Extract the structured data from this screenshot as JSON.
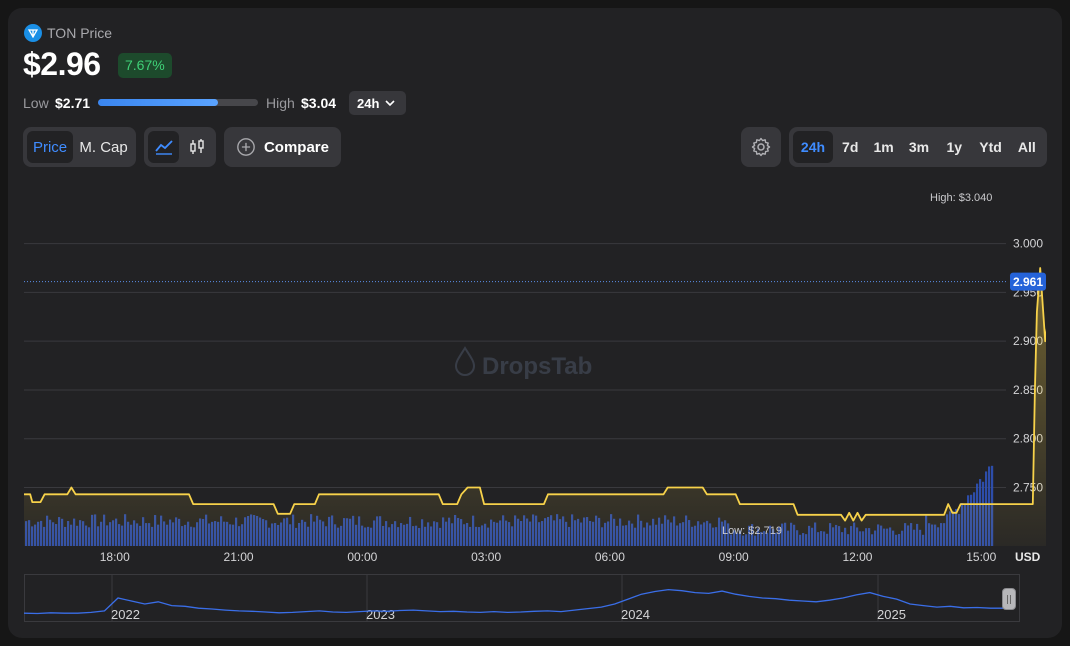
{
  "header": {
    "coin_name": "TON Price",
    "price": "$2.96",
    "change": "7.67%",
    "low_label": "Low",
    "low_value": "$2.71",
    "high_label": "High",
    "high_value": "$3.04",
    "period": "24h",
    "range_position": 0.75
  },
  "toolbar": {
    "price_tab": "Price",
    "mcap_tab": "M. Cap",
    "compare_label": "Compare",
    "ranges": [
      "24h",
      "7d",
      "1m",
      "3m",
      "1y",
      "Ytd",
      "All"
    ],
    "active_range": "24h"
  },
  "colors": {
    "line": "#f7d24a",
    "volume": "#2f52b8",
    "accent": "#3f8cff",
    "positive": "#3fd077",
    "navigator": "#3a6ee8"
  },
  "chart_data": [
    {
      "type": "line",
      "title": "",
      "xlabel": "",
      "ylabel": "USD",
      "x_ticks": [
        "18:00",
        "21:00",
        "00:00",
        "03:00",
        "06:00",
        "09:00",
        "12:00",
        "15:00"
      ],
      "x_range_hours": [
        -2.2,
        21.6
      ],
      "ylim": [
        2.69,
        3.055
      ],
      "y_ticks": [
        3.0,
        2.95,
        2.9,
        2.85,
        2.8,
        2.75
      ],
      "y_tick_labels": [
        "3.000",
        "2.950",
        "2.900",
        "2.850",
        "2.800",
        "2.750"
      ],
      "current_value": 2.961,
      "current_label": "2.961",
      "high_annotation": "High: $3.040",
      "low_annotation": "Low: $2.719",
      "watermark": "DropsTab",
      "series": [
        {
          "points": [
            [
              -2.2,
              2.743
            ],
            [
              -2.05,
              2.743
            ],
            [
              -2.0,
              2.735
            ],
            [
              -1.8,
              2.735
            ],
            [
              -1.7,
              2.743
            ],
            [
              -1.15,
              2.743
            ],
            [
              -1.05,
              2.75
            ],
            [
              -0.95,
              2.743
            ],
            [
              1.8,
              2.743
            ],
            [
              1.9,
              2.733
            ],
            [
              3.85,
              2.733
            ],
            [
              3.95,
              2.723
            ],
            [
              4.25,
              2.723
            ],
            [
              4.35,
              2.733
            ],
            [
              4.85,
              2.733
            ],
            [
              4.95,
              2.743
            ],
            [
              7.85,
              2.743
            ],
            [
              7.95,
              2.733
            ],
            [
              8.3,
              2.733
            ],
            [
              8.4,
              2.743
            ],
            [
              8.55,
              2.75
            ],
            [
              8.85,
              2.75
            ],
            [
              8.95,
              2.733
            ],
            [
              10.4,
              2.733
            ],
            [
              10.5,
              2.743
            ],
            [
              13.3,
              2.743
            ],
            [
              13.4,
              2.75
            ],
            [
              14.25,
              2.75
            ],
            [
              14.35,
              2.743
            ],
            [
              15.05,
              2.743
            ],
            [
              15.15,
              2.733
            ],
            [
              16.45,
              2.733
            ],
            [
              16.55,
              2.722
            ],
            [
              17.6,
              2.722
            ],
            [
              17.7,
              2.716
            ],
            [
              17.8,
              2.724
            ],
            [
              17.9,
              2.716
            ],
            [
              18.0,
              2.724
            ],
            [
              18.1,
              2.716
            ],
            [
              18.2,
              2.722
            ],
            [
              20.1,
              2.722
            ],
            [
              20.2,
              2.733
            ],
            [
              20.3,
              2.724
            ],
            [
              20.4,
              2.724
            ],
            [
              20.5,
              2.733
            ],
            [
              22.25,
              2.733
            ],
            [
              22.3,
              2.85
            ],
            [
              22.35,
              2.93
            ],
            [
              22.43,
              2.975
            ],
            [
              22.55,
              2.9
            ],
            [
              22.72,
              2.955
            ],
            [
              22.82,
              2.99
            ],
            [
              22.92,
              3.04
            ],
            [
              23.05,
              3.01
            ],
            [
              23.15,
              2.975
            ],
            [
              23.25,
              2.961
            ]
          ]
        }
      ],
      "volume_hint": "low through 22:00, rising sharply after"
    },
    {
      "type": "line",
      "title": "",
      "x_ticks": [
        "2022",
        "2023",
        "2024",
        "2025"
      ],
      "series": [
        {
          "values": [
            0.18,
            0.17,
            0.19,
            0.18,
            0.18,
            0.2,
            0.24,
            0.58,
            0.5,
            0.42,
            0.48,
            0.38,
            0.36,
            0.31,
            0.29,
            0.26,
            0.24,
            0.23,
            0.21,
            0.19,
            0.2,
            0.22,
            0.24,
            0.21,
            0.2,
            0.22,
            0.24,
            0.23,
            0.25,
            0.26,
            0.24,
            0.22,
            0.23,
            0.21,
            0.2,
            0.22,
            0.2,
            0.21,
            0.23,
            0.24,
            0.22,
            0.26,
            0.3,
            0.34,
            0.42,
            0.55,
            0.68,
            0.75,
            0.8,
            0.77,
            0.72,
            0.7,
            0.76,
            0.68,
            0.62,
            0.58,
            0.56,
            0.52,
            0.5,
            0.48,
            0.52,
            0.58,
            0.66,
            0.72,
            0.62,
            0.55,
            0.42,
            0.38,
            0.34,
            0.36,
            0.32,
            0.33,
            0.31,
            0.31
          ]
        }
      ]
    }
  ]
}
